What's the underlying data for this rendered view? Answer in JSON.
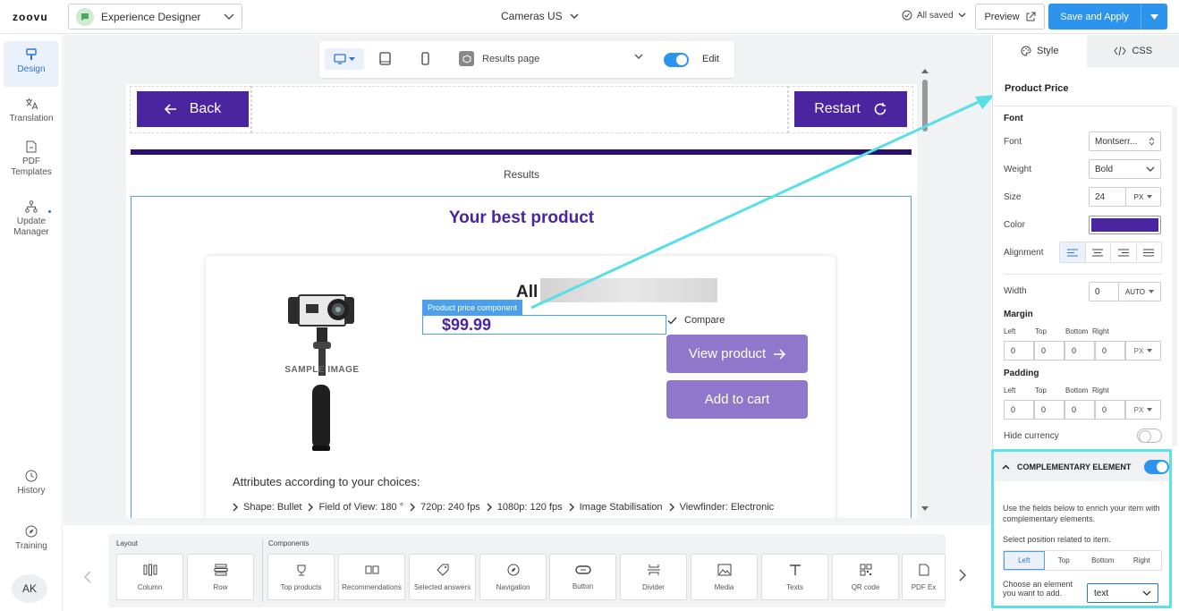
{
  "topbar": {
    "logo": "zoovu",
    "project": "Experience Designer",
    "catalog": "Cameras US",
    "saved_status": "All saved",
    "preview_label": "Preview",
    "save_apply_label": "Save and Apply"
  },
  "rail": {
    "items": [
      {
        "label": "Design",
        "icon": "brush-icon"
      },
      {
        "label": "Translation",
        "icon": "translate-icon"
      },
      {
        "label": "PDF Templates",
        "icon": "pdf-icon"
      },
      {
        "label": "Update Manager",
        "icon": "sitemap-icon"
      },
      {
        "label": "History",
        "icon": "clock-icon"
      },
      {
        "label": "Training",
        "icon": "compass-icon"
      }
    ],
    "avatar": "AK"
  },
  "viewbar": {
    "page_select": "Results page",
    "edit_label": "Edit"
  },
  "canvas": {
    "back_label": "Back",
    "restart_label": "Restart",
    "results_label": "Results",
    "heading": "Your best product",
    "product_title": "All",
    "sample_image": "SAMPLE IMAGE",
    "badge": "Product price component",
    "price": "$99.99",
    "compare_label": "Compare",
    "view_product_label": "View product",
    "add_to_cart_label": "Add to cart",
    "attributes_label": "Attributes according to your choices:",
    "attributes": [
      "Shape: Bullet",
      "Field of View: 180 °",
      "720p: 240 fps",
      "1080p: 120 fps",
      "Image Stabilisation",
      "Viewfinder: Electronic"
    ]
  },
  "tray": {
    "layout_label": "Layout",
    "components_label": "Components",
    "layout_items": [
      "Column",
      "Row"
    ],
    "components": [
      "Top products",
      "Recommendations",
      "Selected answers",
      "Navigation",
      "Button",
      "Divider",
      "Media",
      "Texts",
      "QR code",
      "PDF Ex"
    ]
  },
  "panel": {
    "tabs": [
      "Style",
      "CSS"
    ],
    "title": "Product Price",
    "font_section": "Font",
    "font_label": "Font",
    "font_value": "Montserr...",
    "weight_label": "Weight",
    "weight_value": "Bold",
    "size_label": "Size",
    "size_value": "24",
    "size_unit": "PX",
    "color_label": "Color",
    "color_value": "#4a259f",
    "alignment_label": "Alignment",
    "width_label": "Width",
    "width_value": "0",
    "width_unit": "AUTO",
    "margin_label": "Margin",
    "padding_label": "Padding",
    "side_labels": [
      "Left",
      "Top",
      "Bottom",
      "Right"
    ],
    "margin_values": [
      "0",
      "0",
      "0",
      "0"
    ],
    "padding_values": [
      "0",
      "0",
      "0",
      "0"
    ],
    "box_unit": "PX",
    "hide_currency_label": "Hide currency",
    "complementary": {
      "title": "COMPLEMENTARY ELEMENT",
      "desc": "Use the fields below to enrich your item with complementary elements.",
      "position_label": "Select position related to item.",
      "positions": [
        "Left",
        "Top",
        "Bottom",
        "Right"
      ],
      "choose_label": "Choose an element you want to add.",
      "element_value": "text"
    }
  }
}
